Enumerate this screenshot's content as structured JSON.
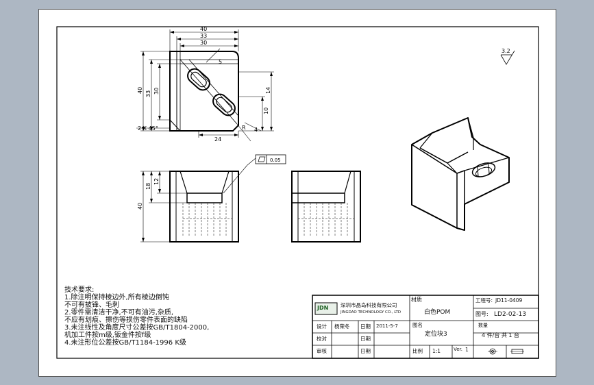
{
  "drawing": {
    "top_view": {
      "dims": {
        "width_40": "40",
        "width_33": "33",
        "width_30": "30",
        "height_40": "40",
        "height_33": "33",
        "height_30": "30",
        "height_14": "14",
        "height_10": "10",
        "offset_24": "24",
        "slot_5": "5",
        "slot_4": "4",
        "slot_r": "R",
        "chamfer": "2 X 45°"
      }
    },
    "front_view": {
      "dims": {
        "height_40": "40",
        "height_18": "18",
        "height_12": "12"
      },
      "flatness_value": "0.05"
    },
    "roughness": "3.2"
  },
  "tech_requirements": {
    "title": "技术要求:",
    "lines": [
      "1.除注明保持棱边外,所有棱边倒钝",
      "  不可有披锋、毛刺",
      "2.零件需清洁干净,不可有油污,杂质,",
      "  不应有划痕、擦伤等损伤零件表面的缺陷",
      "3.未注线性及角度尺寸公差按GB/T1804-2000,",
      "  机加工件按m级,钣金件按f级",
      "4.未注形位公差按GB/T1184-1996 K级"
    ]
  },
  "title_block": {
    "logo": "JDN",
    "company_cn": "深圳市晶岛科技有限公司",
    "company_en": "JINGDAO TECHNOLOGY CO., LTD",
    "material_label": "材质",
    "material_value": "白色POM",
    "project_label": "工程号:",
    "project_value": "JD11-0409",
    "drawing_no_label": "图号:",
    "drawing_no_value": "LD2-02-13",
    "design_label": "设计",
    "designer": "杨荣冬",
    "date_label": "日期",
    "date_value": "2011-5-7",
    "name_label": "图名",
    "name_value": "定位块3",
    "qty_label": "数量",
    "qty_value": "4 件/台  共 1 台",
    "check_label": "校对",
    "review_label": "审核",
    "date_label_2": "日期",
    "date_label_3": "日期",
    "scale_label": "比例",
    "scale_value": "1:1",
    "version_label": "Ver.",
    "version_value": "1"
  }
}
